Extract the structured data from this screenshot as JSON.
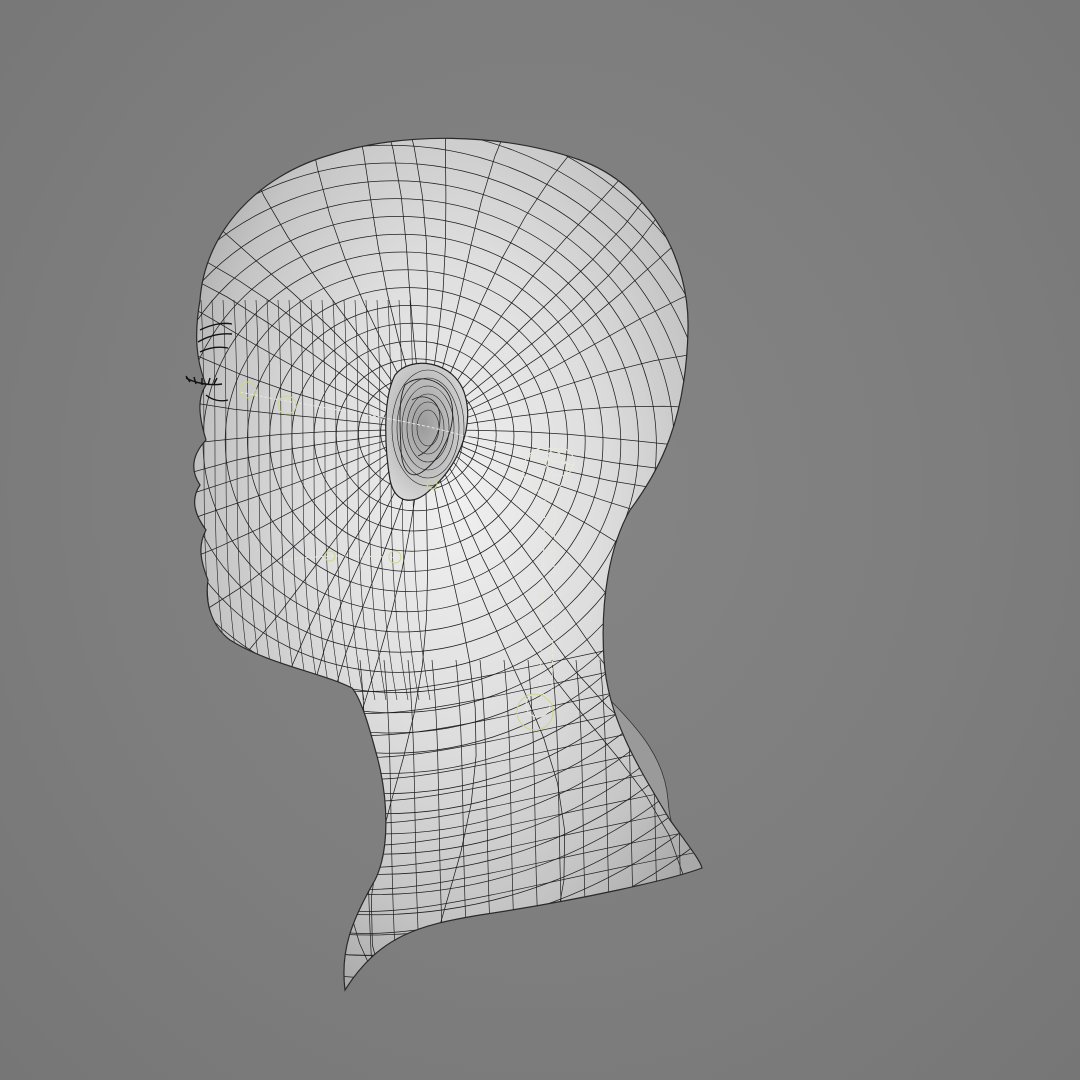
{
  "viewport": {
    "background": "#7c7c7c",
    "model": "head",
    "view": "left-side",
    "display_mode": "wireframe-on-shaded"
  },
  "mesh": {
    "surface_color": "#d9d9d9",
    "wire_color": "#1e1e1e",
    "rig_color": "#e6e6dc",
    "highlight_color": "#c9d98a"
  }
}
